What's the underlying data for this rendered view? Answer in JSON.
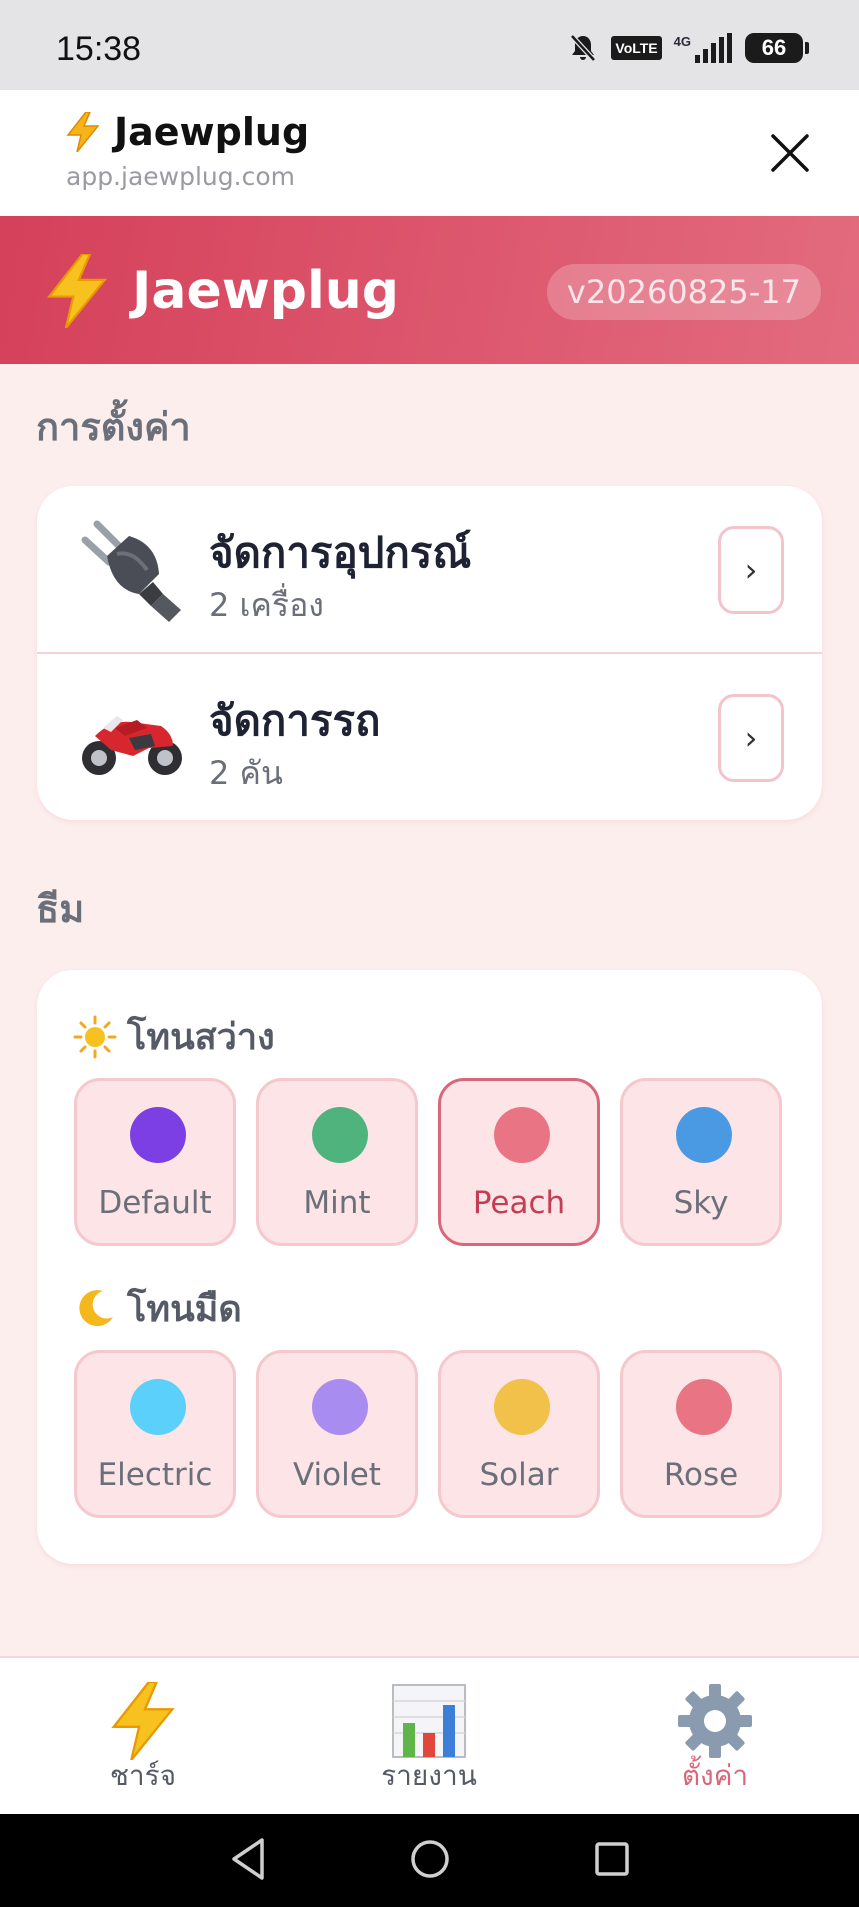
{
  "status_bar": {
    "time": "15:38",
    "network": "4G",
    "volte": "VoLTE",
    "battery": "66"
  },
  "browser": {
    "title": "Jaewplug",
    "url": "app.jaewplug.com"
  },
  "app_header": {
    "title": "Jaewplug",
    "version": "v20260825-17"
  },
  "settings": {
    "section_title": "การตั้งค่า",
    "items": [
      {
        "title": "จัดการอุปกรณ์",
        "subtitle": "2 เครื่อง",
        "icon": "plug-icon",
        "chevron": "›"
      },
      {
        "title": "จัดการรถ",
        "subtitle": "2 คัน",
        "icon": "motorcycle-icon",
        "chevron": "›"
      }
    ]
  },
  "theme": {
    "section_title": "ธีม",
    "light": {
      "label": "โทนสว่าง",
      "icon": "sun-icon",
      "options": [
        {
          "name": "Default",
          "color": "#7b3fe4",
          "selected": false
        },
        {
          "name": "Mint",
          "color": "#4fb37e",
          "selected": false
        },
        {
          "name": "Peach",
          "color": "#e97584",
          "selected": true
        },
        {
          "name": "Sky",
          "color": "#4a9ae3",
          "selected": false
        }
      ]
    },
    "dark": {
      "label": "โทนมืด",
      "icon": "moon-icon",
      "options": [
        {
          "name": "Electric",
          "color": "#5ad0fa",
          "selected": false
        },
        {
          "name": "Violet",
          "color": "#a98cf0",
          "selected": false
        },
        {
          "name": "Solar",
          "color": "#f2c14a",
          "selected": false
        },
        {
          "name": "Rose",
          "color": "#e97584",
          "selected": false
        }
      ]
    }
  },
  "bottom_nav": [
    {
      "label": "ชาร์จ",
      "icon": "lightning-icon",
      "active": false
    },
    {
      "label": "รายงาน",
      "icon": "bar-chart-icon",
      "active": false
    },
    {
      "label": "ตั้งค่า",
      "icon": "gear-icon",
      "active": true
    }
  ],
  "colors": {
    "accent": "#d5405a",
    "background": "#fdeeee"
  }
}
